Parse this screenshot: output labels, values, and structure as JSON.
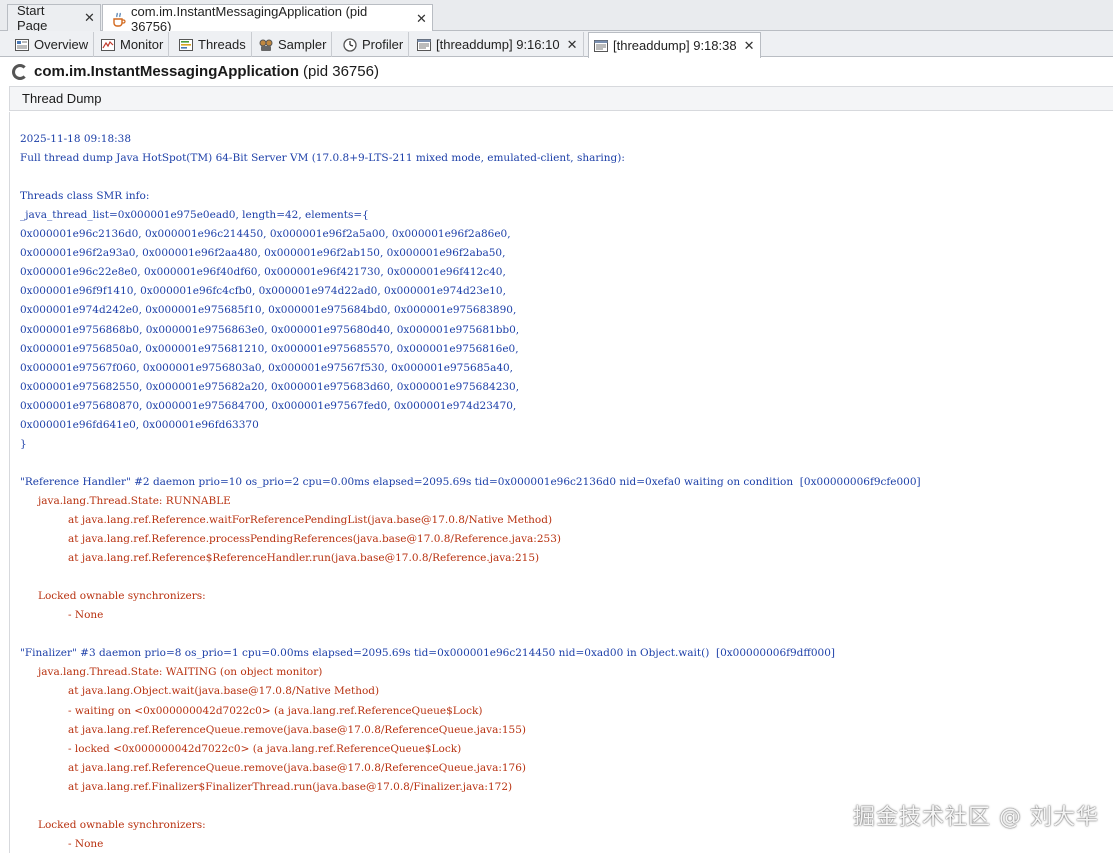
{
  "doc_tabs": {
    "start_page": "Start Page",
    "app_tab": "com.im.InstantMessagingApplication (pid 36756)"
  },
  "sub_tabs": {
    "overview": "Overview",
    "monitor": "Monitor",
    "threads": "Threads",
    "sampler": "Sampler",
    "profiler": "Profiler",
    "dump1": "[threaddump] 9:16:10",
    "dump2": "[threaddump] 9:18:38"
  },
  "title": {
    "app": "com.im.InstantMessagingApplication",
    "pid": "(pid 36756)"
  },
  "section": "Thread Dump",
  "dump_lines": [
    {
      "text": "2025-11-18 09:18:38",
      "color": "blue",
      "indent": 0
    },
    {
      "text": "Full thread dump Java HotSpot(TM) 64-Bit Server VM (17.0.8+9-LTS-211 mixed mode, emulated-client, sharing):",
      "color": "blue",
      "indent": 0
    },
    {
      "text": "",
      "color": "blue",
      "indent": 0
    },
    {
      "text": "Threads class SMR info:",
      "color": "blue",
      "indent": 0
    },
    {
      "text": "_java_thread_list=0x000001e975e0ead0, length=42, elements={",
      "color": "blue",
      "indent": 0
    },
    {
      "text": "0x000001e96c2136d0, 0x000001e96c214450, 0x000001e96f2a5a00, 0x000001e96f2a86e0,",
      "color": "blue",
      "indent": 0
    },
    {
      "text": "0x000001e96f2a93a0, 0x000001e96f2aa480, 0x000001e96f2ab150, 0x000001e96f2aba50,",
      "color": "blue",
      "indent": 0
    },
    {
      "text": "0x000001e96c22e8e0, 0x000001e96f40df60, 0x000001e96f421730, 0x000001e96f412c40,",
      "color": "blue",
      "indent": 0
    },
    {
      "text": "0x000001e96f9f1410, 0x000001e96fc4cfb0, 0x000001e974d22ad0, 0x000001e974d23e10,",
      "color": "blue",
      "indent": 0
    },
    {
      "text": "0x000001e974d242e0, 0x000001e975685f10, 0x000001e975684bd0, 0x000001e975683890,",
      "color": "blue",
      "indent": 0
    },
    {
      "text": "0x000001e9756868b0, 0x000001e9756863e0, 0x000001e975680d40, 0x000001e975681bb0,",
      "color": "blue",
      "indent": 0
    },
    {
      "text": "0x000001e9756850a0, 0x000001e975681210, 0x000001e975685570, 0x000001e9756816e0,",
      "color": "blue",
      "indent": 0
    },
    {
      "text": "0x000001e97567f060, 0x000001e9756803a0, 0x000001e97567f530, 0x000001e975685a40,",
      "color": "blue",
      "indent": 0
    },
    {
      "text": "0x000001e975682550, 0x000001e975682a20, 0x000001e975683d60, 0x000001e975684230,",
      "color": "blue",
      "indent": 0
    },
    {
      "text": "0x000001e975680870, 0x000001e975684700, 0x000001e97567fed0, 0x000001e974d23470,",
      "color": "blue",
      "indent": 0
    },
    {
      "text": "0x000001e96fd641e0, 0x000001e96fd63370",
      "color": "blue",
      "indent": 0
    },
    {
      "text": "}",
      "color": "blue",
      "indent": 0
    },
    {
      "text": "",
      "color": "blue",
      "indent": 0
    },
    {
      "text": "\"Reference Handler\" #2 daemon prio=10 os_prio=2 cpu=0.00ms elapsed=2095.69s tid=0x000001e96c2136d0 nid=0xefa0 waiting on condition  [0x00000006f9cfe000]",
      "color": "blue",
      "indent": 0
    },
    {
      "text": "java.lang.Thread.State: RUNNABLE",
      "color": "red",
      "indent": 1
    },
    {
      "text": "at java.lang.ref.Reference.waitForReferencePendingList(java.base@17.0.8/Native Method)",
      "color": "red",
      "indent": 2
    },
    {
      "text": "at java.lang.ref.Reference.processPendingReferences(java.base@17.0.8/Reference.java:253)",
      "color": "red",
      "indent": 2
    },
    {
      "text": "at java.lang.ref.Reference$ReferenceHandler.run(java.base@17.0.8/Reference.java:215)",
      "color": "red",
      "indent": 2
    },
    {
      "text": "",
      "color": "red",
      "indent": 0
    },
    {
      "text": "Locked ownable synchronizers:",
      "color": "red",
      "indent": 1
    },
    {
      "text": "- None",
      "color": "red",
      "indent": 2
    },
    {
      "text": "",
      "color": "red",
      "indent": 0
    },
    {
      "text": "\"Finalizer\" #3 daemon prio=8 os_prio=1 cpu=0.00ms elapsed=2095.69s tid=0x000001e96c214450 nid=0xad00 in Object.wait()  [0x00000006f9dff000]",
      "color": "blue",
      "indent": 0
    },
    {
      "text": "java.lang.Thread.State: WAITING (on object monitor)",
      "color": "red",
      "indent": 1
    },
    {
      "text": "at java.lang.Object.wait(java.base@17.0.8/Native Method)",
      "color": "red",
      "indent": 2
    },
    {
      "text": "- waiting on <0x000000042d7022c0> (a java.lang.ref.ReferenceQueue$Lock)",
      "color": "red",
      "indent": 2
    },
    {
      "text": "at java.lang.ref.ReferenceQueue.remove(java.base@17.0.8/ReferenceQueue.java:155)",
      "color": "red",
      "indent": 2
    },
    {
      "text": "- locked <0x000000042d7022c0> (a java.lang.ref.ReferenceQueue$Lock)",
      "color": "red",
      "indent": 2
    },
    {
      "text": "at java.lang.ref.ReferenceQueue.remove(java.base@17.0.8/ReferenceQueue.java:176)",
      "color": "red",
      "indent": 2
    },
    {
      "text": "at java.lang.ref.Finalizer$FinalizerThread.run(java.base@17.0.8/Finalizer.java:172)",
      "color": "red",
      "indent": 2
    },
    {
      "text": "",
      "color": "red",
      "indent": 0
    },
    {
      "text": "Locked ownable synchronizers:",
      "color": "red",
      "indent": 1
    },
    {
      "text": "- None",
      "color": "red",
      "indent": 2
    }
  ],
  "watermark": "掘金技术社区 @ 刘大华",
  "colors": {
    "blue": "#1c3fa8",
    "red": "#b83210"
  },
  "icons": [
    "java-cup-icon",
    "close-icon",
    "overview-icon",
    "monitor-icon",
    "threads-icon",
    "sampler-icon",
    "profiler-icon",
    "threaddump-icon",
    "spinner-icon"
  ]
}
